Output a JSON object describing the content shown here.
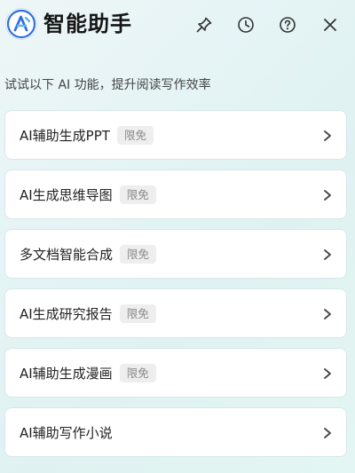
{
  "header": {
    "title": "智能助手",
    "logo_icon": "assistant-logo-icon",
    "buttons": [
      {
        "name": "pin-button",
        "icon": "pin-icon"
      },
      {
        "name": "history-button",
        "icon": "clock-icon"
      },
      {
        "name": "help-button",
        "icon": "question-icon"
      },
      {
        "name": "close-button",
        "icon": "close-icon"
      }
    ]
  },
  "subtitle": "试试以下 AI 功能，提升阅读写作效率",
  "items": [
    {
      "label": "AI辅助生成PPT",
      "badge": "限免"
    },
    {
      "label": "AI生成思维导图",
      "badge": "限免"
    },
    {
      "label": "多文档智能合成",
      "badge": "限免"
    },
    {
      "label": "AI生成研究报告",
      "badge": "限免"
    },
    {
      "label": "AI辅助生成漫画",
      "badge": "限免"
    },
    {
      "label": "AI辅助写作小说",
      "badge": ""
    }
  ],
  "colors": {
    "logo_blue": "#2f6fe0",
    "text": "#222222",
    "badge_bg": "#eeeeee",
    "badge_text": "#8a8a8a",
    "card_border": "#d6e8e8"
  }
}
